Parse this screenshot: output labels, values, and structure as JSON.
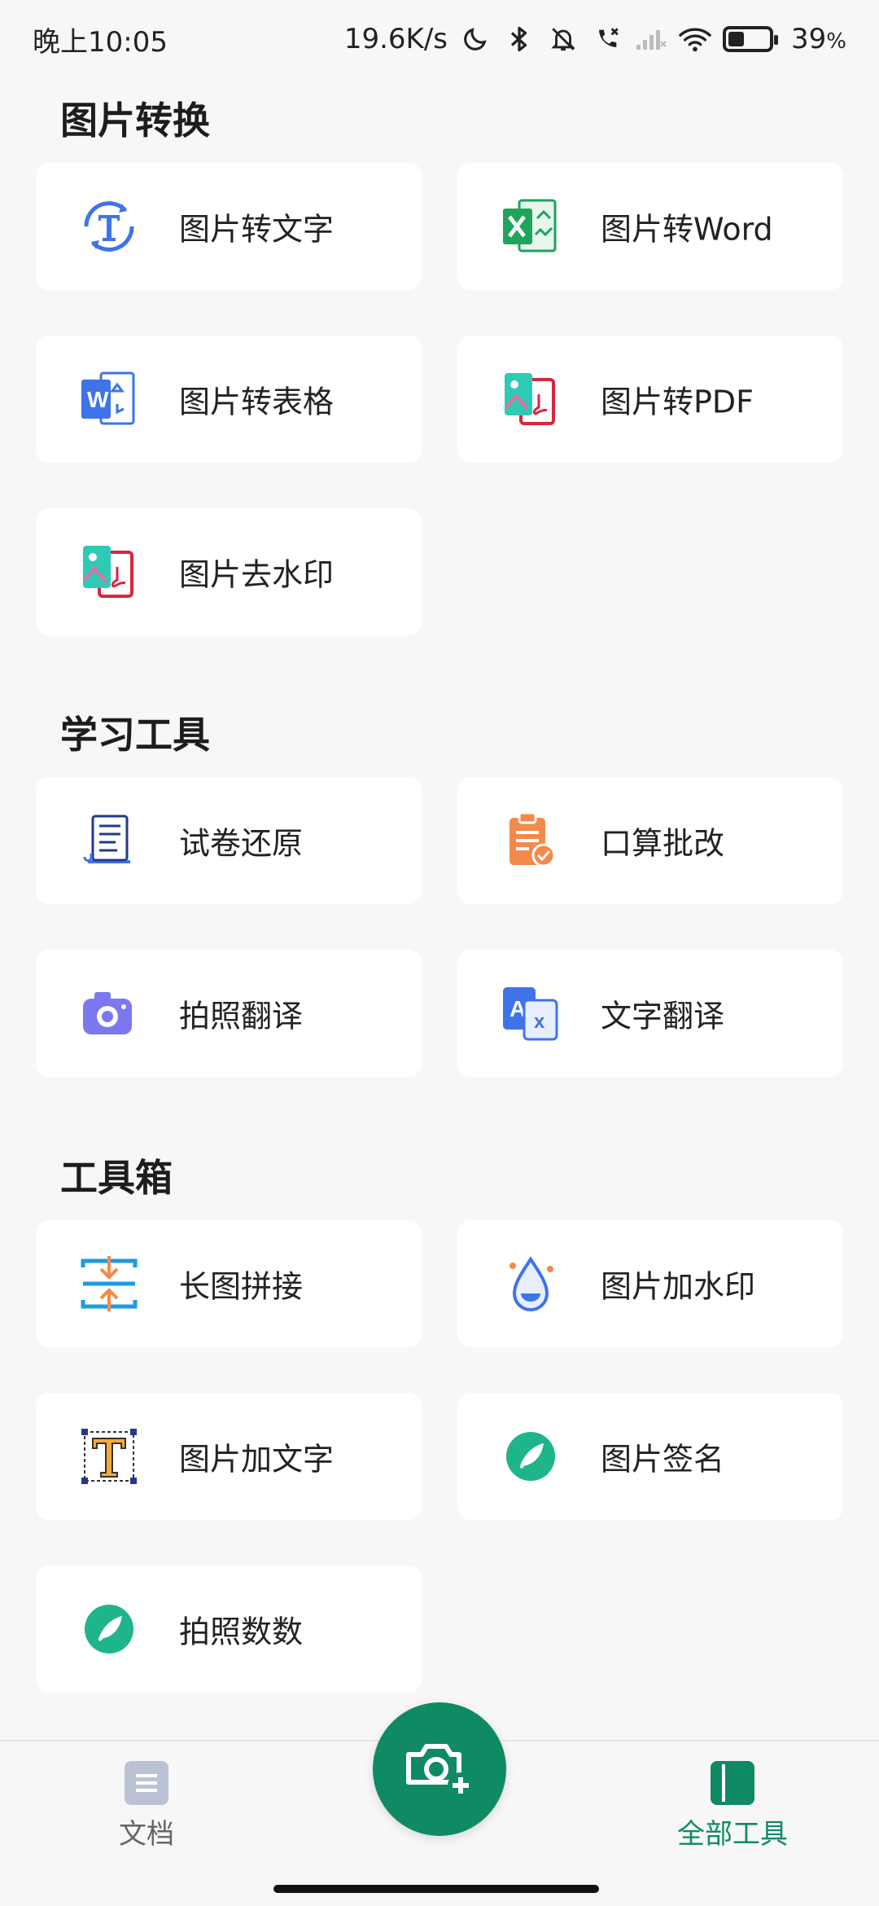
{
  "status_bar": {
    "time": "晚上10:05",
    "net_speed": "19.6K/s",
    "battery_text": "39",
    "battery_unit": "%",
    "battery_level": 0.39
  },
  "sections": {
    "image_convert": {
      "title": "图片转换",
      "items": [
        "图片转文字",
        "图片转Word",
        "图片转表格",
        "图片转PDF",
        "图片去水印"
      ]
    },
    "study_tools": {
      "title": "学习工具",
      "items": [
        "试卷还原",
        "口算批改",
        "拍照翻译",
        "文字翻译"
      ]
    },
    "toolbox": {
      "title": "工具箱",
      "items": [
        "长图拼接",
        "图片加水印",
        "图片加文字",
        "图片签名",
        "拍照数数"
      ]
    }
  },
  "bottom_nav": {
    "docs_label": "文档",
    "tools_label": "全部工具"
  },
  "colors": {
    "accent": "#0f8a65",
    "background": "#f7f7f7",
    "card": "#ffffff"
  }
}
